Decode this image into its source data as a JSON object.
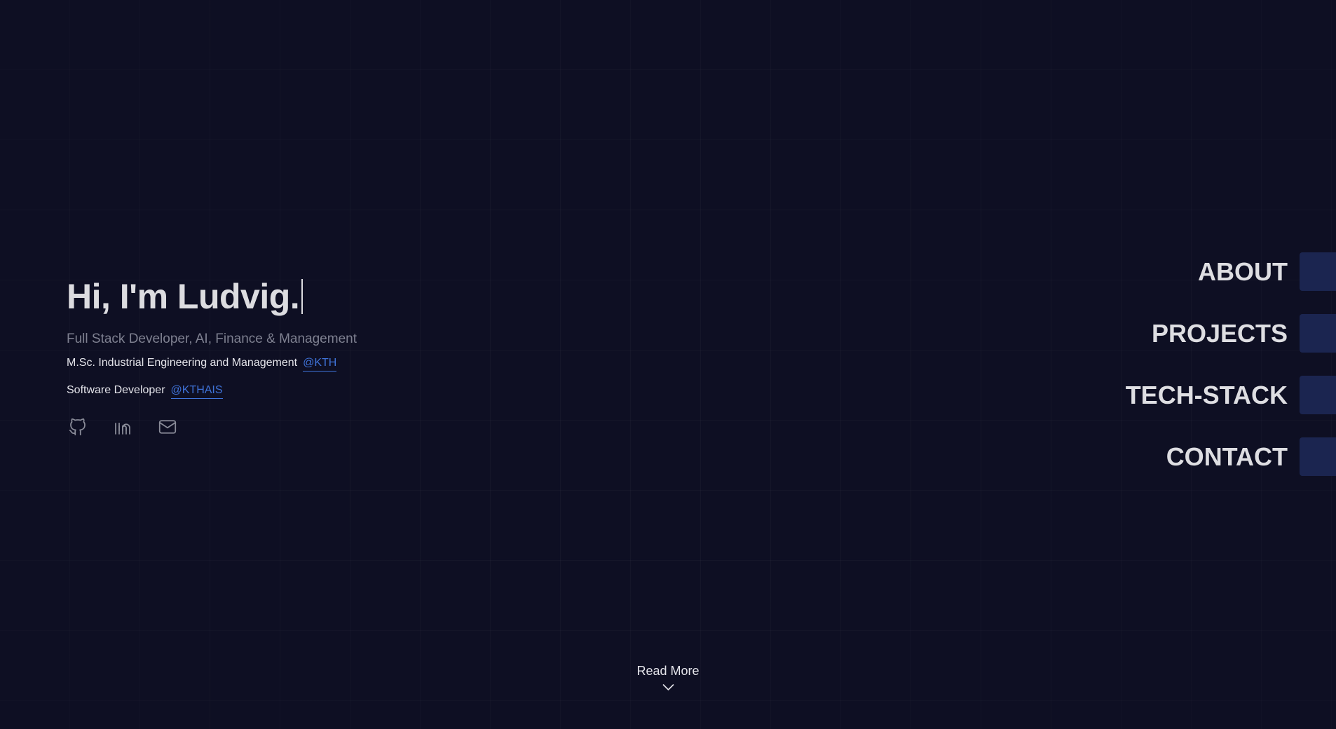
{
  "hero": {
    "headline": "Hi, I'm Ludvig.",
    "subtitle": "Full Stack Developer, AI, Finance & Management",
    "roles": [
      {
        "title": "M.Sc. Industrial Engineering and Management",
        "org": "@KTH"
      },
      {
        "title": "Software Developer",
        "org": "@KTHAIS"
      }
    ],
    "socials": [
      {
        "icon": "github-icon"
      },
      {
        "icon": "linkedin-icon"
      },
      {
        "icon": "mail-icon"
      }
    ]
  },
  "nav": {
    "items": [
      {
        "label": "ABOUT"
      },
      {
        "label": "PROJECTS"
      },
      {
        "label": "TECH-STACK"
      },
      {
        "label": "CONTACT"
      }
    ]
  },
  "read_more": {
    "label": "Read More",
    "icon": "chevron-down-icon"
  },
  "colors": {
    "background": "#0e0f23",
    "accent_link": "#3f73d9",
    "nav_tab": "#1b2550",
    "text_primary": "#dcdce0",
    "text_muted": "#7e8090"
  }
}
